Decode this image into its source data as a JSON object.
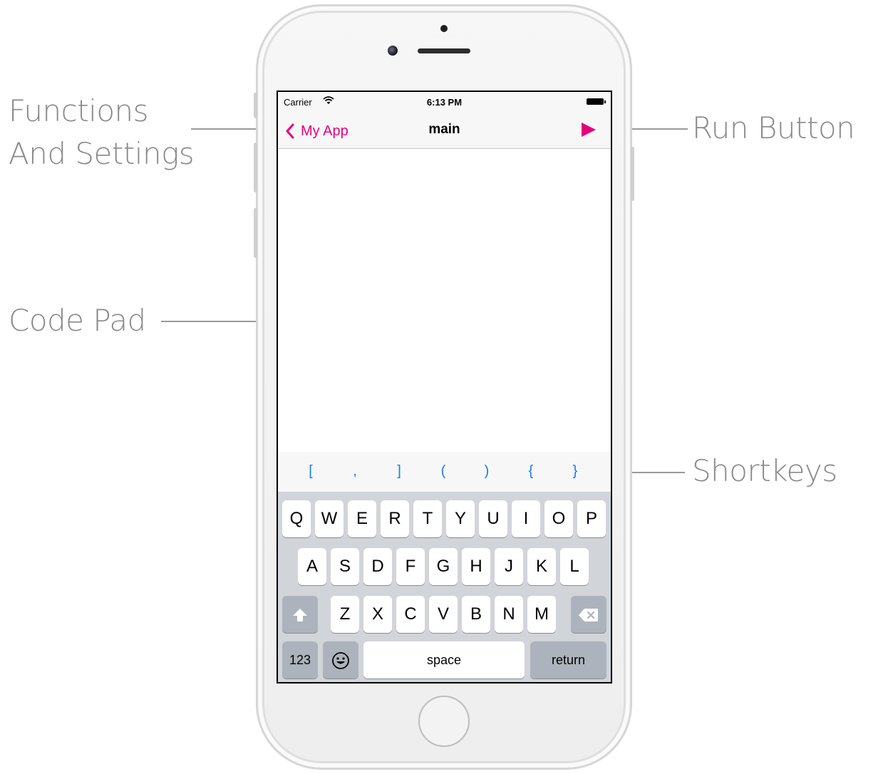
{
  "callouts": {
    "functions_line1": "Functions",
    "functions_line2": "And Settings",
    "code_pad": "Code Pad",
    "run_button": "Run Button",
    "shortkeys": "Shortkeys"
  },
  "status_bar": {
    "carrier": "Carrier",
    "time": "6:13 PM"
  },
  "nav_bar": {
    "back_label": "My App",
    "title": "main"
  },
  "shortkeys": [
    "[",
    ",",
    "]",
    "(",
    ")",
    "{",
    "}"
  ],
  "keyboard": {
    "row1": [
      "Q",
      "W",
      "E",
      "R",
      "T",
      "Y",
      "U",
      "I",
      "O",
      "P"
    ],
    "row2": [
      "A",
      "S",
      "D",
      "F",
      "G",
      "H",
      "J",
      "K",
      "L"
    ],
    "row3": [
      "Z",
      "X",
      "C",
      "V",
      "B",
      "N",
      "M"
    ],
    "numbers_label": "123",
    "space_label": "space",
    "return_label": "return"
  },
  "colors": {
    "accent": "#e4007f",
    "shortkey_blue": "#1a7cf0",
    "keyboard_bg": "#d1d4d9"
  },
  "icons": {
    "back": "chevron-left-icon",
    "run": "play-icon",
    "wifi": "wifi-icon",
    "battery": "battery-icon",
    "shift": "shift-icon",
    "delete": "delete-icon",
    "emoji": "emoji-icon"
  }
}
